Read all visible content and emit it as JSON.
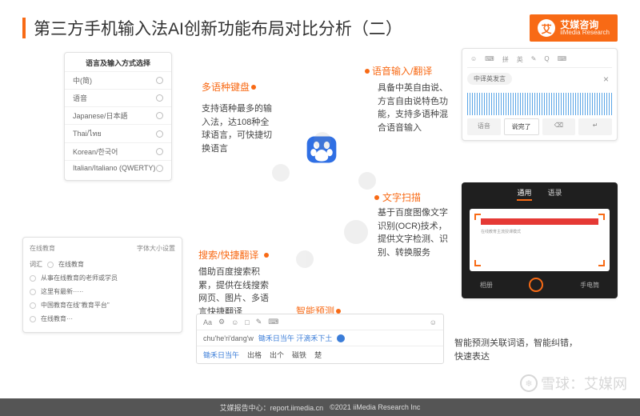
{
  "title": "第三方手机输入法AI创新功能布局对比分析（二）",
  "brand": {
    "cn": "艾媒咨询",
    "en": "iiMedia Research",
    "glyph": "艾"
  },
  "features": {
    "multilang": {
      "label": "多语种键盘",
      "desc": "支持语种最多的输入法，达108种全球语言，可快捷切换语言"
    },
    "voice": {
      "label": "语音输入/翻译",
      "desc": "具备中英自由说、方言自由说特色功能，支持多语种混合语音输入"
    },
    "search": {
      "label": "搜索/快捷翻译",
      "desc": "借助百度搜索积累，提供在线搜索网页、图片、多语言快捷翻译"
    },
    "ocr": {
      "label": "文字扫描",
      "desc": "基于百度图像文字识别(OCR)技术，提供文字检测、识别、转换服务"
    },
    "predict": {
      "label": "智能预测",
      "desc": "智能预测关联词语，智能纠错，快速表达"
    }
  },
  "lang_panel": {
    "header": "语言及输入方式选择",
    "items": [
      "中(简)",
      "语音",
      "Japanese/日本語",
      "Thai/ไทย",
      "Korean/한국어",
      "Italian/Italiano (QWERTY)"
    ]
  },
  "search_panel": {
    "tab_left": "在线教育",
    "tab_right": "字体大小设置",
    "col1": "词汇",
    "col2": "在线教育",
    "items": [
      "从事在线教育的老师或学员",
      "这里有最新·····",
      "中国教育在线\"教育平台\"",
      "在线教育···"
    ]
  },
  "voice_panel": {
    "tabs": [
      "☺",
      "⌨",
      "拼",
      "英",
      "✎",
      "Q",
      "⌨"
    ],
    "pill": "中译英发言",
    "close": "×",
    "btns": [
      "语音",
      "说完了",
      "⌫",
      "↵"
    ]
  },
  "ocr_panel": {
    "tabs": [
      "通用",
      "语录"
    ],
    "preview_title": "在线教育主流授课模式",
    "bottom": [
      "相册",
      "拍照",
      "手电筒"
    ]
  },
  "predict_bar": {
    "icons": [
      "Aa",
      "⚙",
      "☺",
      "□",
      "✎",
      "⌨",
      "☺"
    ],
    "pinyin": "chu'he'ri'dang'w",
    "suggestion": "锄禾日当午 汗滴禾下土",
    "candidates": [
      "锄禾日当午",
      "出格",
      "出个",
      "磁铁",
      "楚"
    ]
  },
  "footer": {
    "left": "艾媒报告中心：report.iimedia.cn",
    "right": "©2021 iiMedia Research Inc"
  },
  "watermark": "雪球：艾媒网"
}
